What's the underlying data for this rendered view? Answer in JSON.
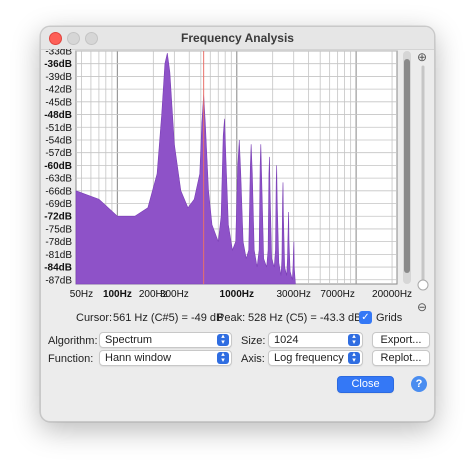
{
  "window": {
    "title": "Frequency Analysis"
  },
  "chart_data": {
    "type": "area",
    "y_ticks": [
      "-33dB",
      "-36dB",
      "-39dB",
      "-42dB",
      "-45dB",
      "-48dB",
      "-51dB",
      "-54dB",
      "-57dB",
      "-60dB",
      "-63dB",
      "-66dB",
      "-69dB",
      "-72dB",
      "-75dB",
      "-78dB",
      "-81dB",
      "-84dB",
      "-87dB"
    ],
    "y_bold": [
      "-36dB",
      "-48dB",
      "-60dB",
      "-72dB",
      "-84dB"
    ],
    "ylim": [
      -88,
      -33
    ],
    "x_scale": "log",
    "xlim": [
      45,
      22000
    ],
    "x_ticks": [
      {
        "value": 50,
        "label": "50Hz",
        "bold": false
      },
      {
        "value": 100,
        "label": "100Hz",
        "bold": true
      },
      {
        "value": 200,
        "label": "200Hz",
        "bold": false
      },
      {
        "value": 300,
        "label": "300Hz",
        "bold": false
      },
      {
        "value": 1000,
        "label": "1000Hz",
        "bold": true
      },
      {
        "value": 3000,
        "label": "3000Hz",
        "bold": false
      },
      {
        "value": 7000,
        "label": "7000Hz",
        "bold": false
      },
      {
        "value": 20000,
        "label": "20000Hz",
        "bold": false
      }
    ],
    "series": [
      {
        "color": "#8e52c8",
        "points": [
          [
            45,
            -66
          ],
          [
            70,
            -68
          ],
          [
            100,
            -72
          ],
          [
            140,
            -72
          ],
          [
            180,
            -70
          ],
          [
            215,
            -62
          ],
          [
            235,
            -48
          ],
          [
            250,
            -36
          ],
          [
            262,
            -33.5
          ],
          [
            275,
            -38
          ],
          [
            300,
            -55
          ],
          [
            340,
            -66
          ],
          [
            390,
            -70
          ],
          [
            440,
            -68
          ],
          [
            490,
            -62
          ],
          [
            510,
            -50
          ],
          [
            528,
            -43.3
          ],
          [
            545,
            -50
          ],
          [
            580,
            -66
          ],
          [
            620,
            -74
          ],
          [
            700,
            -78
          ],
          [
            740,
            -72
          ],
          [
            770,
            -53
          ],
          [
            790,
            -49
          ],
          [
            810,
            -58
          ],
          [
            850,
            -74
          ],
          [
            920,
            -80
          ],
          [
            980,
            -78
          ],
          [
            1020,
            -60
          ],
          [
            1050,
            -54
          ],
          [
            1080,
            -62
          ],
          [
            1130,
            -78
          ],
          [
            1200,
            -82
          ],
          [
            1260,
            -80
          ],
          [
            1300,
            -60
          ],
          [
            1320,
            -55
          ],
          [
            1350,
            -62
          ],
          [
            1400,
            -80
          ],
          [
            1480,
            -84
          ],
          [
            1540,
            -80
          ],
          [
            1570,
            -60
          ],
          [
            1590,
            -55
          ],
          [
            1620,
            -64
          ],
          [
            1680,
            -82
          ],
          [
            1780,
            -84
          ],
          [
            1830,
            -80
          ],
          [
            1860,
            -62
          ],
          [
            1880,
            -58
          ],
          [
            1900,
            -66
          ],
          [
            1960,
            -82
          ],
          [
            2060,
            -84
          ],
          [
            2110,
            -80
          ],
          [
            2140,
            -64
          ],
          [
            2160,
            -60
          ],
          [
            2180,
            -68
          ],
          [
            2250,
            -83
          ],
          [
            2350,
            -86
          ],
          [
            2390,
            -82
          ],
          [
            2420,
            -68
          ],
          [
            2440,
            -64
          ],
          [
            2460,
            -72
          ],
          [
            2520,
            -84
          ],
          [
            2620,
            -86
          ],
          [
            2660,
            -82
          ],
          [
            2700,
            -74
          ],
          [
            2720,
            -71
          ],
          [
            2740,
            -78
          ],
          [
            2800,
            -85
          ],
          [
            2920,
            -87
          ],
          [
            2960,
            -84
          ],
          [
            2990,
            -80
          ],
          [
            3010,
            -78
          ],
          [
            3030,
            -84
          ],
          [
            3100,
            -88
          ]
        ]
      }
    ],
    "cursor": {
      "frequency_hz": 561,
      "db": -49
    },
    "peak": {
      "frequency_hz": 528,
      "db": -43.3
    }
  },
  "readouts": {
    "cursor_label": "Cursor:",
    "cursor_value": "561 Hz (C#5) = -49 dB",
    "peak_label": "Peak:",
    "peak_value": "528 Hz (C5) = -43.3 dB",
    "grids_label": "Grids",
    "grids_checked": true
  },
  "controls": {
    "algorithm_label": "Algorithm:",
    "algorithm_value": "Spectrum",
    "size_label": "Size:",
    "size_value": "1024",
    "function_label": "Function:",
    "function_value": "Hann window",
    "axis_label": "Axis:",
    "axis_value": "Log frequency",
    "export_label": "Export...",
    "replot_label": "Replot...",
    "close_label": "Close",
    "help_label": "?"
  },
  "zoom": {
    "in_icon": "zoom-in-icon",
    "out_icon": "zoom-out-icon"
  }
}
